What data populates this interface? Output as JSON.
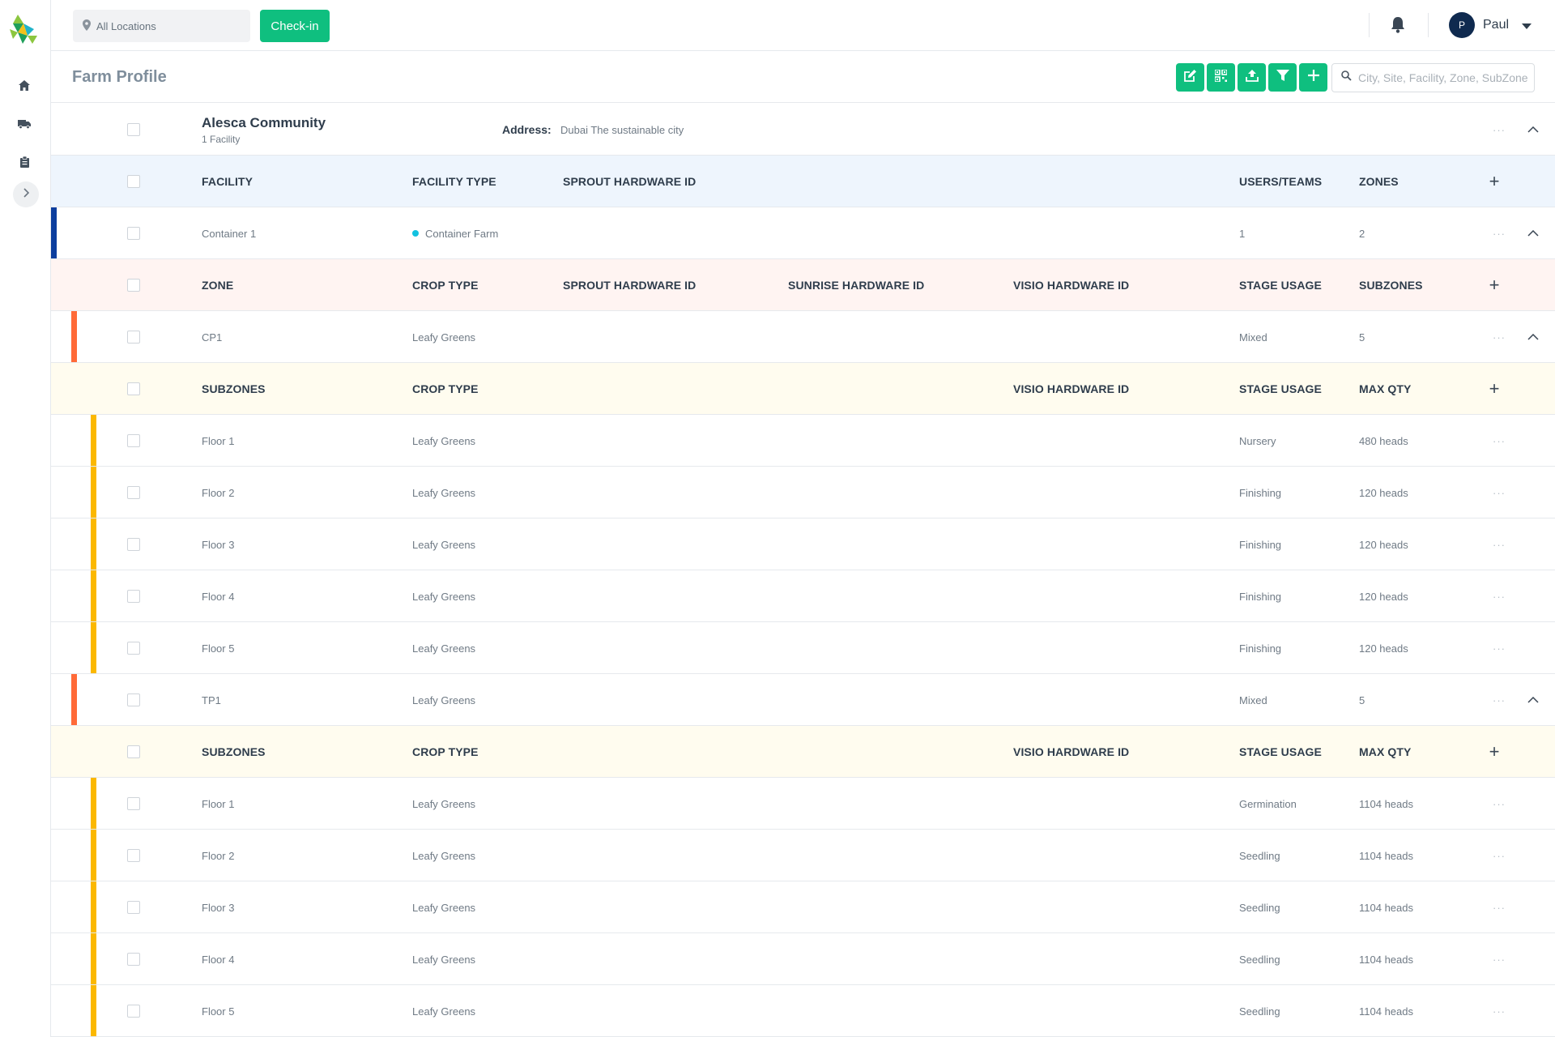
{
  "topbar": {
    "location_placeholder": "All Locations",
    "checkin_label": "Check-in",
    "user": {
      "initial": "P",
      "name": "Paul"
    }
  },
  "page": {
    "title": "Farm Profile",
    "search_placeholder": "City, Site, Facility, Zone, SubZone"
  },
  "site": {
    "name": "Alesca Community",
    "facility_count": "1 Facility",
    "address_label": "Address:",
    "address": "Dubai The sustainable city"
  },
  "facility_headers": {
    "facility": "FACILITY",
    "facility_type": "FACILITY TYPE",
    "sprout_id": "SPROUT HARDWARE ID",
    "users_teams": "USERS/TEAMS",
    "zones": "ZONES"
  },
  "facility": {
    "name": "Container 1",
    "type": "Container Farm",
    "users": "1",
    "zones": "2"
  },
  "zone_headers": {
    "zone": "ZONE",
    "crop_type": "CROP TYPE",
    "sprout_id": "SPROUT HARDWARE ID",
    "sunrise_id": "SUNRISE HARDWARE ID",
    "visio_id": "VISIO HARDWARE ID",
    "stage_usage": "STAGE USAGE",
    "subzones": "SUBZONES"
  },
  "subzone_headers": {
    "subzones": "SUBZONES",
    "crop_type": "CROP TYPE",
    "visio_id": "VISIO HARDWARE ID",
    "stage_usage": "STAGE USAGE",
    "max_qty": "MAX QTY"
  },
  "zones": [
    {
      "name": "CP1",
      "crop": "Leafy Greens",
      "stage": "Mixed",
      "subzones": "5",
      "items": [
        {
          "name": "Floor 1",
          "crop": "Leafy Greens",
          "stage": "Nursery",
          "qty": "480 heads"
        },
        {
          "name": "Floor 2",
          "crop": "Leafy Greens",
          "stage": "Finishing",
          "qty": "120 heads"
        },
        {
          "name": "Floor 3",
          "crop": "Leafy Greens",
          "stage": "Finishing",
          "qty": "120 heads"
        },
        {
          "name": "Floor 4",
          "crop": "Leafy Greens",
          "stage": "Finishing",
          "qty": "120 heads"
        },
        {
          "name": "Floor 5",
          "crop": "Leafy Greens",
          "stage": "Finishing",
          "qty": "120 heads"
        }
      ]
    },
    {
      "name": "TP1",
      "crop": "Leafy Greens",
      "stage": "Mixed",
      "subzones": "5",
      "items": [
        {
          "name": "Floor 1",
          "crop": "Leafy Greens",
          "stage": "Germination",
          "qty": "1104 heads"
        },
        {
          "name": "Floor 2",
          "crop": "Leafy Greens",
          "stage": "Seedling",
          "qty": "1104 heads"
        },
        {
          "name": "Floor 3",
          "crop": "Leafy Greens",
          "stage": "Seedling",
          "qty": "1104 heads"
        },
        {
          "name": "Floor 4",
          "crop": "Leafy Greens",
          "stage": "Seedling",
          "qty": "1104 heads"
        },
        {
          "name": "Floor 5",
          "crop": "Leafy Greens",
          "stage": "Seedling",
          "qty": "1104 heads"
        }
      ]
    }
  ],
  "icons": {
    "sidebar": [
      "home-icon",
      "truck-icon",
      "clipboard-icon",
      "chevron-right-icon"
    ],
    "toolbar": [
      "edit-icon",
      "qr-code-icon",
      "upload-icon",
      "filter-icon",
      "plus-icon"
    ]
  },
  "colors": {
    "accent": "#0fbf7f",
    "facility_bar": "#0c3e9e",
    "zone_bar": "#ff6a38",
    "subzone_bar": "#fbb800"
  }
}
